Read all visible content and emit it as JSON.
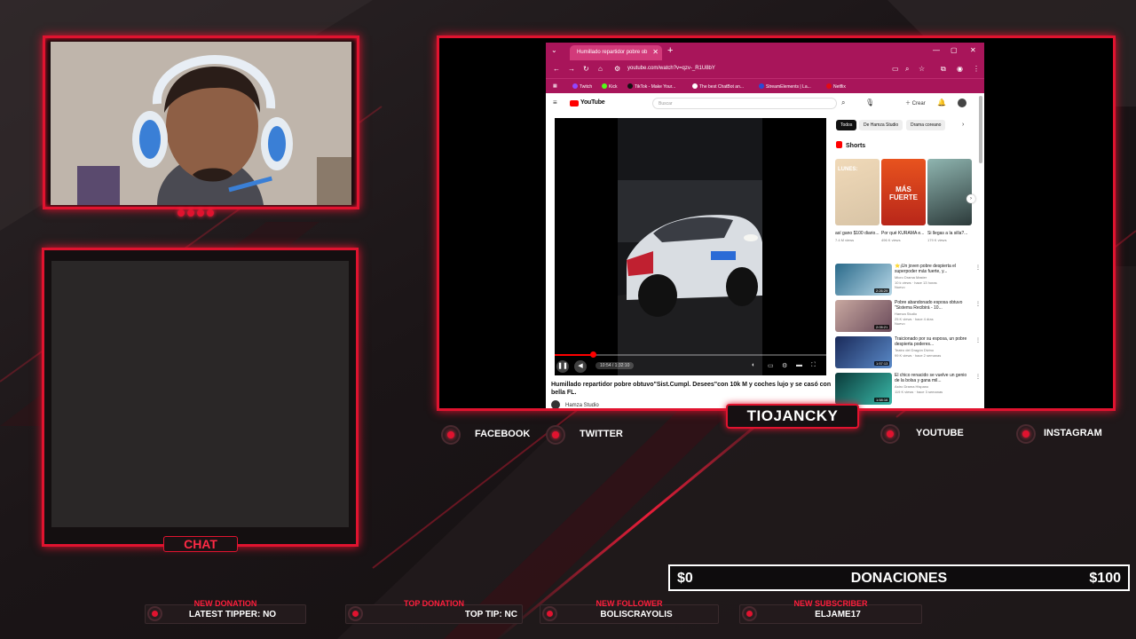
{
  "overlay": {
    "streamer_name": "TIOJANCKY",
    "chat_label": "CHAT",
    "socials": [
      {
        "label": "FACEBOOK",
        "icon": "facebook-icon"
      },
      {
        "label": "TWITTER",
        "icon": "twitter-icon"
      },
      {
        "label": "YOUTUBE",
        "icon": "youtube-icon"
      },
      {
        "label": "INSTAGRAM",
        "icon": "instagram-icon"
      }
    ],
    "donation_goal": {
      "min": "$0",
      "label": "DONACIONES",
      "max": "$100",
      "progress": 0
    },
    "alerts": [
      {
        "title": "NEW DONATION",
        "value": "LATEST TIPPER: NO"
      },
      {
        "title": "TOP DONATION",
        "value": "TOP TIP: NC"
      },
      {
        "title": "NEW FOLLOWER",
        "value": "BOLISCRAYOLIS"
      },
      {
        "title": "NEW SUBSCRIBER",
        "value": "ELJAME17"
      }
    ],
    "accent_color": "#e0132f"
  },
  "browser": {
    "tab_title": "Humillado repartidor pobre ob",
    "url": "youtube.com/watch?v=qzv-_R1U8bY",
    "bookmarks": [
      "Twitch",
      "Kick",
      "TikTok - Make Your...",
      "The best ChatBot an...",
      "StreamElements | La...",
      "Netflix"
    ]
  },
  "youtube": {
    "logo": "YouTube",
    "search_placeholder": "Buscar",
    "create_label": "Crear",
    "player": {
      "time": "10:54 / 1:32:10",
      "progress": 0.14
    },
    "video_title": "Humillado repartidor pobre obtuvo\"Sist.Cumpl. Desees\"con 10k M y coches lujo y se casó con bella FL.",
    "channel": "Hamza Studio",
    "chips": [
      "Todos",
      "De Hamza Studio",
      "Drama coreano"
    ],
    "shorts_header": "Shorts",
    "shorts": [
      {
        "thumb_text": "LUNES:",
        "title": "así gano $100 diario...",
        "views": "7.4 M views"
      },
      {
        "thumb_text": "MÁS FUERTE",
        "title": "Por qué KURAMA e...",
        "views": "496 K views"
      },
      {
        "thumb_text": "",
        "title": "Si llegas a la silla?...",
        "views": "179 K views"
      }
    ],
    "recommended": [
      {
        "title": "⭐¡Un joven pobre despierta el superpoder más fuerte, y...",
        "channel": "Micro Drama Master",
        "meta": "10 k views · hace 13 horas",
        "badge": "Nuevo",
        "duration": "2:26:29"
      },
      {
        "title": "Pobre abandonado esposa obtuvo \"Sistema Recibirá - 10...",
        "channel": "Hamza Studio",
        "meta": "25 K views · hace 4 días",
        "badge": "Nuevo",
        "duration": "2:05:21"
      },
      {
        "title": "Traicionado por su esposa, un pobre despierta poderes...",
        "channel": "Teatro del Dragón Divino",
        "meta": "99 K views · hace 2 semanas",
        "badge": "",
        "duration": "1:57:13"
      },
      {
        "title": "El chico renacido se vuelve un genio de la bolsa y gana mil...",
        "channel": "Astro Drama Hispano",
        "meta": "119 K views · hace 3 semanas",
        "badge": "",
        "duration": "1:58:16"
      }
    ]
  }
}
